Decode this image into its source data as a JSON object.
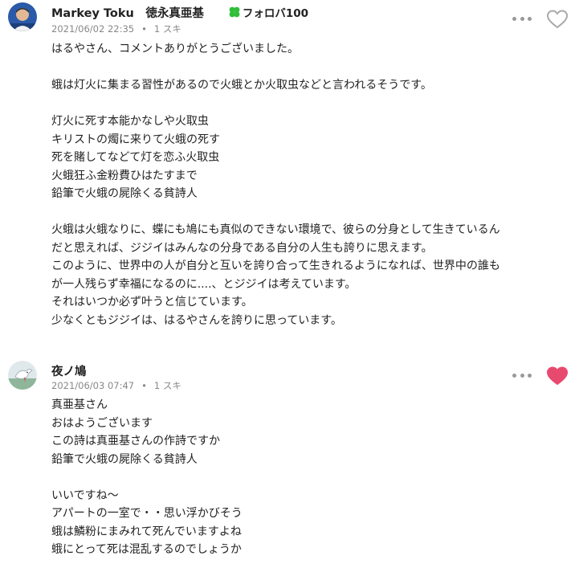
{
  "comments": [
    {
      "author": "Markey Toku　徳永真亜基",
      "fan_badge": "フォロバ100",
      "date": "2021/06/02 22:35",
      "likes": "1 スキ",
      "liked": false,
      "avatar_icon": "user-photo-avatar",
      "lines": [
        "はるやさん、コメントありがとうございました。",
        "",
        "蛾は灯火に集まる習性があるので火蛾とか火取虫などと言われるそうです。",
        "",
        "灯火に死す本能かなしや火取虫",
        "キリストの燭に来りて火蛾の死す",
        "死を賭してなどて灯を恋ふ火取虫",
        "火蛾狂ふ金粉費ひはたすまで",
        "鉛筆で火蛾の屍除くる貧詩人",
        "",
        "火蛾は火蛾なりに、蝶にも鳩にも真似のできない環境で、彼らの分身として生きているん",
        "だと思えれば、ジジイはみんなの分身である自分の人生も誇りに思えます。",
        "このように、世界中の人が自分と互いを誇り合って生きれるようになれば、世界中の誰も",
        "が一人残らず幸福になるのに....、とジジイは考えています。",
        "それはいつか必ず叶うと信じています。",
        "少なくともジジイは、はるやさんを誇りに思っています。"
      ]
    },
    {
      "author": "夜ノ鳩",
      "date": "2021/06/03 07:47",
      "likes": "1 スキ",
      "liked": true,
      "avatar_icon": "dove-avatar",
      "lines": [
        "真亜基さん",
        "おはようございます",
        "この詩は真亜基さんの作詩ですか",
        "鉛筆で火蛾の屍除くる貧詩人",
        "",
        "いいですね〜",
        "アパートの一室で・・思い浮かびそう",
        "蛾は鱗粉にまみれて死んでいますよね",
        "蛾にとって死は混乱するのでしょうか"
      ]
    }
  ],
  "colors": {
    "liked_heart": "#e84a6f",
    "unliked_heart": "#aaaaaa",
    "clover": "#2fbf3a",
    "meta_text": "#888888"
  },
  "icons": {
    "menu": "more-dots-icon",
    "like": "heart-icon",
    "badge": "clover-icon"
  }
}
